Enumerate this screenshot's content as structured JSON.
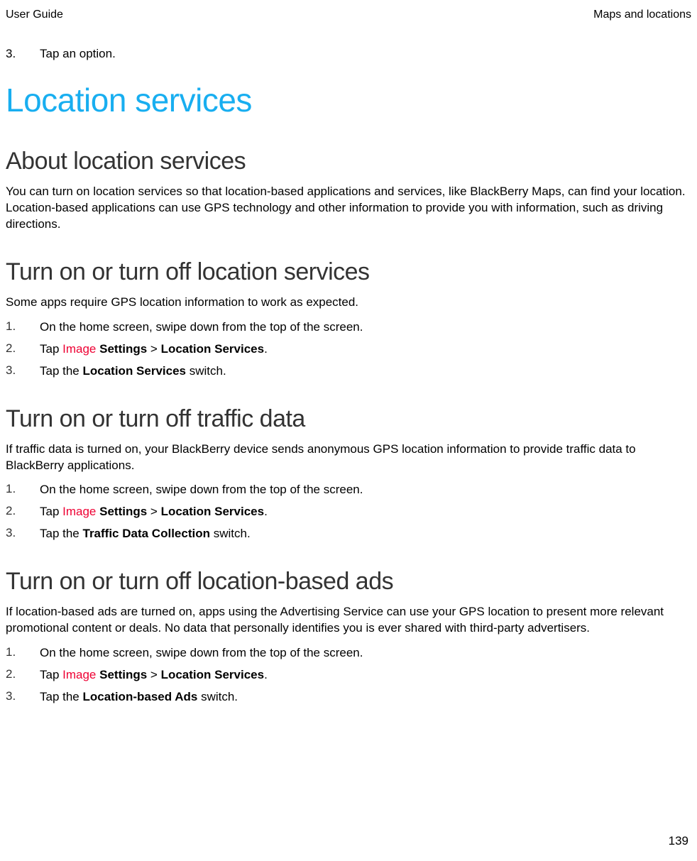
{
  "header": {
    "left": "User Guide",
    "right": "Maps and locations"
  },
  "pre_step": {
    "num": "3.",
    "text": "Tap an option."
  },
  "title": "Location services",
  "sections": {
    "about": {
      "heading": "About location services",
      "para": "You can turn on location services so that location-based applications and services, like BlackBerry Maps, can find your location. Location-based applications can use GPS technology and other information to provide you with information, such as driving directions."
    },
    "loc": {
      "heading": "Turn on or turn off location services",
      "para": "Some apps require GPS location information to work as expected.",
      "s1": {
        "num": "1.",
        "text": "On the home screen, swipe down from the top of the screen."
      },
      "s2": {
        "num": "2.",
        "tap": "Tap ",
        "image": "Image",
        "space": " ",
        "settings": "Settings",
        "sep": " > ",
        "ls": "Location Services",
        "dot": "."
      },
      "s3": {
        "num": "3.",
        "pre": "Tap the ",
        "bold": "Location Services",
        "post": " switch."
      }
    },
    "traffic": {
      "heading": "Turn on or turn off traffic data",
      "para": "If traffic data is turned on, your BlackBerry device sends anonymous GPS location information to provide traffic data to BlackBerry applications.",
      "s1": {
        "num": "1.",
        "text": "On the home screen, swipe down from the top of the screen."
      },
      "s2": {
        "num": "2.",
        "tap": "Tap ",
        "image": "Image",
        "space": " ",
        "settings": "Settings",
        "sep": " > ",
        "ls": "Location Services",
        "dot": "."
      },
      "s3": {
        "num": "3.",
        "pre": "Tap the ",
        "bold": "Traffic Data Collection",
        "post": " switch."
      }
    },
    "ads": {
      "heading": "Turn on or turn off location-based ads",
      "para": "If location-based ads are turned on, apps using the Advertising Service can use your GPS location to present more relevant promotional content or deals. No data that personally identifies you is ever shared with third-party advertisers.",
      "s1": {
        "num": "1.",
        "text": "On the home screen, swipe down from the top of the screen."
      },
      "s2": {
        "num": "2.",
        "tap": "Tap ",
        "image": "Image",
        "space": " ",
        "settings": "Settings",
        "sep": " > ",
        "ls": "Location Services",
        "dot": "."
      },
      "s3": {
        "num": "3.",
        "pre": "Tap the ",
        "bold": "Location-based Ads",
        "post": " switch."
      }
    }
  },
  "page_num": "139"
}
